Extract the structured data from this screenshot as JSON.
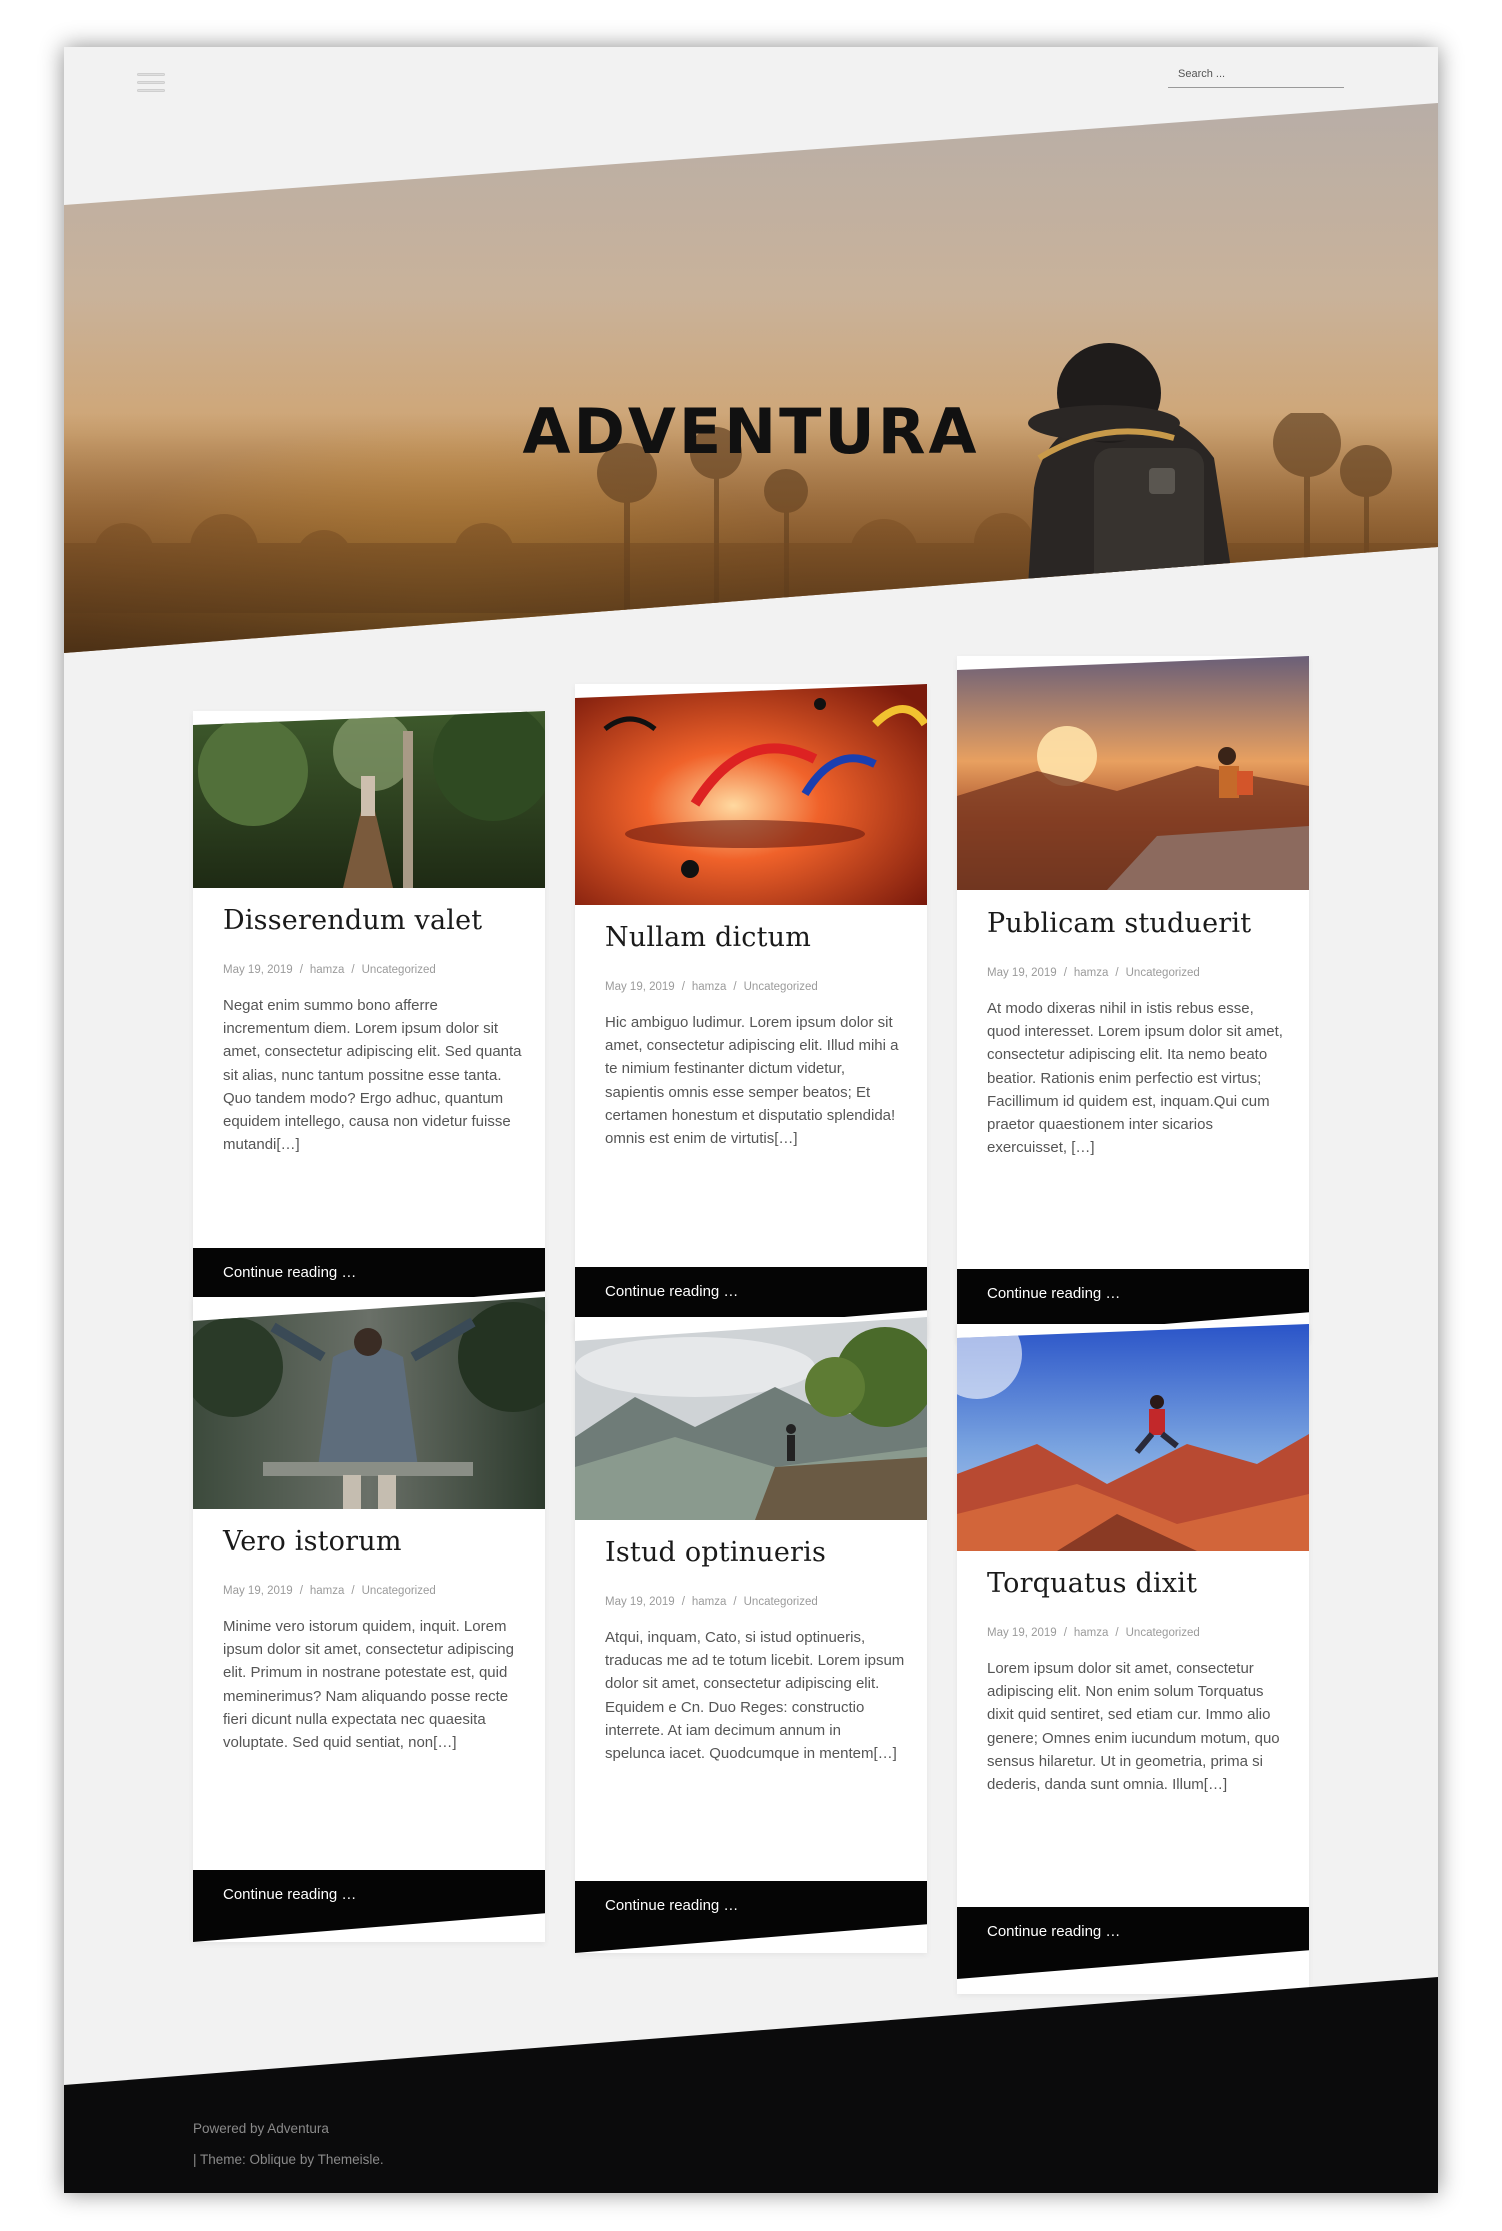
{
  "header": {
    "search_placeholder": "Search ...",
    "menu_icon": "hamburger-menu-icon"
  },
  "hero": {
    "site_title": "ADVENTURA"
  },
  "posts": [
    {
      "title": "Disserendum valet",
      "date": "May 19, 2019",
      "author": "hamza",
      "category": "Uncategorized",
      "excerpt": "Negat enim summo bono afferre incrementum diem. Lorem ipsum dolor sit amet, consectetur adipiscing elit. Sed quanta sit alias, nunc tantum possitne esse tanta. Quo tandem modo? Ergo adhuc, quantum equidem intellego, causa non videtur fuisse mutandi[…]",
      "more": "Continue reading …",
      "image": "jungle-walkway-photo"
    },
    {
      "title": "Nullam dictum",
      "date": "May 19, 2019",
      "author": "hamza",
      "category": "Uncategorized",
      "excerpt": "Hic ambiguo ludimur. Lorem ipsum dolor sit amet, consectetur adipiscing elit. Illud mihi a te nimium festinanter dictum videtur, sapientis omnis esse semper beatos; Et certamen honestum et disputatio splendida! omnis est enim de virtutis[…]",
      "more": "Continue reading …",
      "image": "paragliders-sunset-photo"
    },
    {
      "title": "Publicam studuerit",
      "date": "May 19, 2019",
      "author": "hamza",
      "category": "Uncategorized",
      "excerpt": "At modo dixeras nihil in istis rebus esse, quod interesset. Lorem ipsum dolor sit amet, consectetur adipiscing elit. Ita nemo beato beatior. Rationis enim perfectio est virtus; Facillimum id quidem est, inquam.Qui cum praetor quaestionem inter sicarios exercuisset, […]",
      "more": "Continue reading …",
      "image": "hiker-sunrise-photo"
    },
    {
      "title": "Vero istorum",
      "date": "May 19, 2019",
      "author": "hamza",
      "category": "Uncategorized",
      "excerpt": "Minime vero istorum quidem, inquit. Lorem ipsum dolor sit amet, consectetur adipiscing elit. Primum in nostrane potestate est, quid meminerimus? Nam aliquando posse recte fieri dicunt nulla expectata nec quaesita voluptate. Sed quid sentiat, non[…]",
      "more": "Continue reading …",
      "image": "forest-swing-photo"
    },
    {
      "title": "Istud optinueris",
      "date": "May 19, 2019",
      "author": "hamza",
      "category": "Uncategorized",
      "excerpt": "Atqui, inquam, Cato, si istud optinueris, traducas me ad te totum licebit. Lorem ipsum dolor sit amet, consectetur adipiscing elit. Equidem e Cn. Duo Reges: constructio interrete. At iam decimum annum in spelunca iacet. Quodcumque in mentem[…]",
      "more": "Continue reading …",
      "image": "mountain-cliff-photo"
    },
    {
      "title": "Torquatus dixit",
      "date": "May 19, 2019",
      "author": "hamza",
      "category": "Uncategorized",
      "excerpt": "Lorem ipsum dolor sit amet, consectetur adipiscing elit. Non enim solum Torquatus dixit quid sentiret, sed etiam cur. Immo alio genere; Omnes enim iucundum motum, quo sensus hilaretur. Ut in geometria, prima si dederis, danda sunt omnia. Illum[…]",
      "more": "Continue reading …",
      "image": "red-rocks-jumper-photo"
    }
  ],
  "footer": {
    "powered_prefix": "Powered by ",
    "powered_link": "Adventura",
    "theme_prefix": "| Theme: ",
    "theme_link": "Oblique",
    "theme_by": " by ",
    "author_link": "Themeisle."
  }
}
